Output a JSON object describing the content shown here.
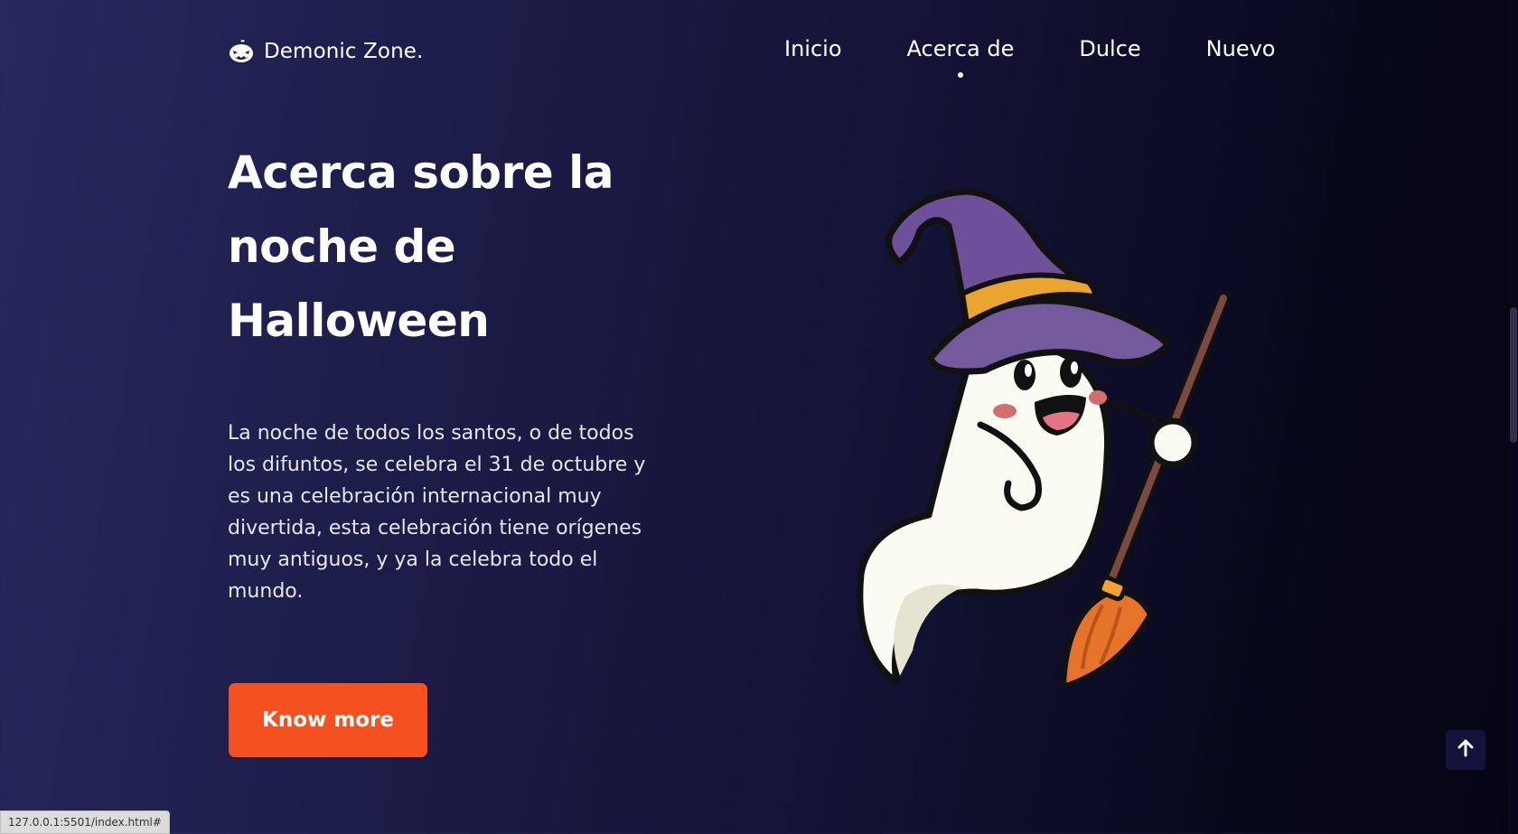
{
  "brand": {
    "name": "Demonic Zone.",
    "icon": "jack-o-lantern-icon"
  },
  "nav": {
    "items": [
      {
        "label": "Inicio"
      },
      {
        "label": "Acerca de",
        "active": true
      },
      {
        "label": "Dulce"
      },
      {
        "label": "Nuevo"
      }
    ]
  },
  "hero": {
    "title": "Acerca sobre la noche de Halloween",
    "description": "La noche de todos los santos, o de todos los difuntos, se celebra el 31 de octubre y es una celebración internacional muy divertida, esta celebración tiene orígenes muy antiguos, y ya la celebra todo el mundo.",
    "button_label": "Know more",
    "illustration": "witch-ghost-with-broom"
  },
  "scroll_top": {
    "icon": "arrow-up-icon"
  },
  "status_bar": {
    "url": "127.0.0.1:5501/index.html#"
  },
  "colors": {
    "accent": "#f5501f",
    "background_start": "#28285e",
    "background_end": "#050512"
  }
}
